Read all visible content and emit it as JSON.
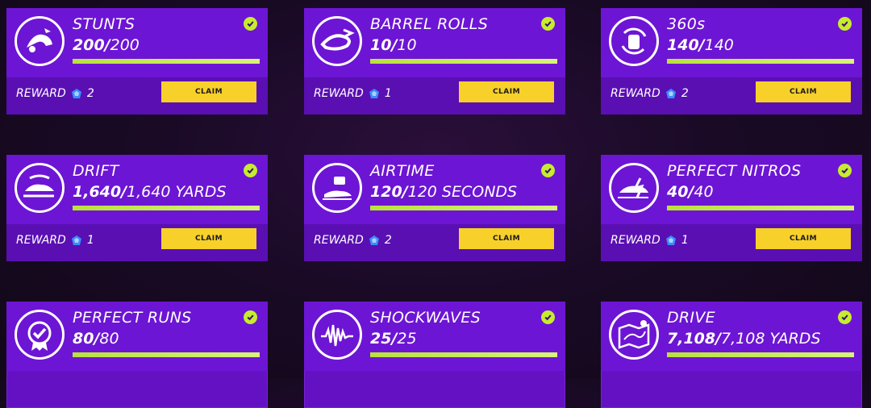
{
  "cards": [
    {
      "title": "STUNTS",
      "current": "200/",
      "total": "200",
      "reward_label": "REWARD",
      "reward_value": "2",
      "claim_label": "CLAIM",
      "progress_fraction": 1.0,
      "icon": "stunt-car-icon"
    },
    {
      "title": "BARREL ROLLS",
      "current": "10/",
      "total": "10",
      "reward_label": "REWARD",
      "reward_value": "1",
      "claim_label": "CLAIM",
      "progress_fraction": 1.0,
      "icon": "barrel-roll-icon"
    },
    {
      "title": "360s",
      "current": "140/",
      "total": "140",
      "reward_label": "REWARD",
      "reward_value": "2",
      "claim_label": "CLAIM",
      "progress_fraction": 1.0,
      "icon": "spin-360-icon"
    },
    {
      "title": "DRIFT",
      "current": "1,640/",
      "total": "1,640 YARDS",
      "reward_label": "REWARD",
      "reward_value": "1",
      "claim_label": "CLAIM",
      "progress_fraction": 1.0,
      "icon": "drift-car-icon"
    },
    {
      "title": "AIRTIME",
      "current": "120/",
      "total": "120 SECONDS",
      "reward_label": "REWARD",
      "reward_value": "2",
      "claim_label": "CLAIM",
      "progress_fraction": 1.0,
      "icon": "airtime-car-icon"
    },
    {
      "title": "PERFECT NITROS",
      "current": "40/",
      "total": "40",
      "reward_label": "REWARD",
      "reward_value": "1",
      "claim_label": "CLAIM",
      "progress_fraction": 1.0,
      "icon": "nitro-car-icon"
    },
    {
      "title": "PERFECT RUNS",
      "current": "80/",
      "total": "80",
      "progress_fraction": 1.0,
      "icon": "badge-check-icon"
    },
    {
      "title": "SHOCKWAVES",
      "current": "25/",
      "total": "25",
      "progress_fraction": 1.0,
      "icon": "shockwave-icon"
    },
    {
      "title": "DRIVE",
      "current": "7,108/",
      "total": "7,108 YARDS",
      "progress_fraction": 1.0,
      "icon": "map-route-icon"
    }
  ],
  "colors": {
    "check": "#c6ec2f",
    "claim": "#f7d02a",
    "card": "#6d15d4",
    "gem": "#3a8cff"
  }
}
